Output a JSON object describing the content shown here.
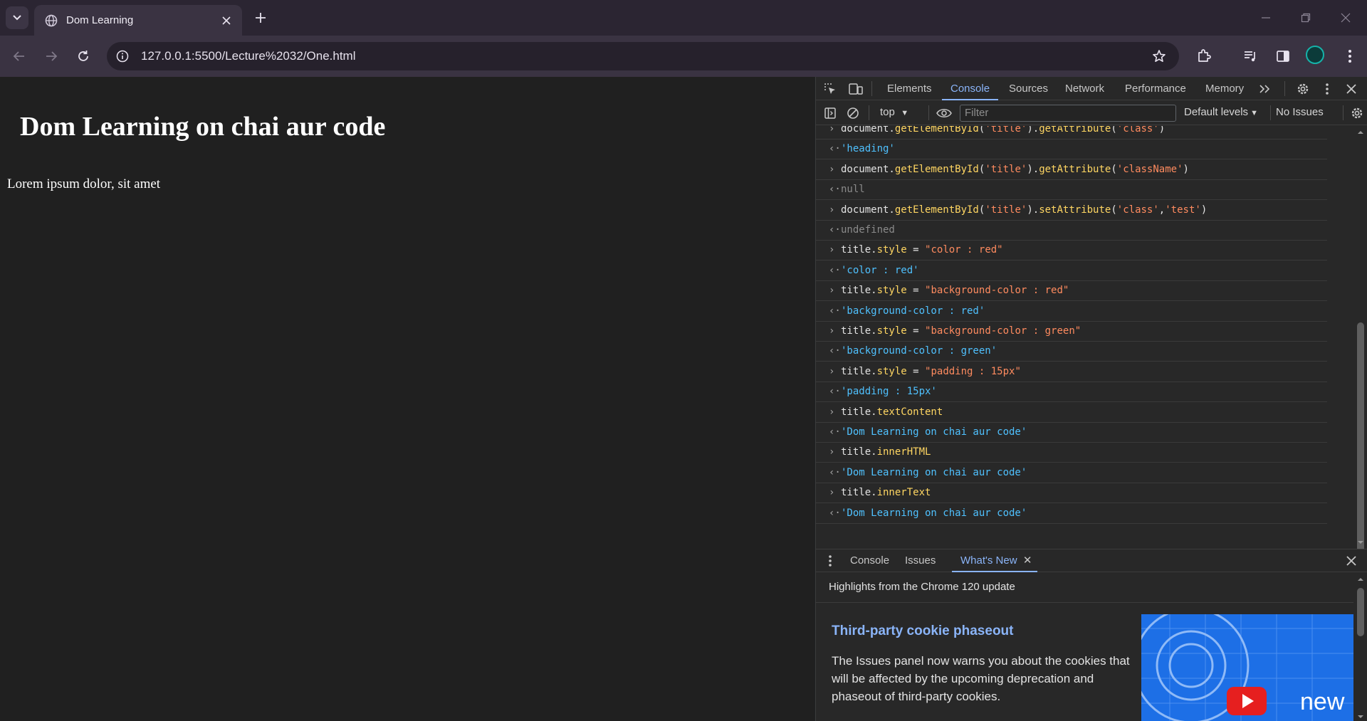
{
  "browser": {
    "tab_title": "Dom Learning",
    "url": "127.0.0.1:5500/Lecture%2032/One.html"
  },
  "page": {
    "heading": "Dom Learning on chai aur code",
    "paragraph": "Lorem ipsum dolor, sit amet"
  },
  "devtools": {
    "tabs": [
      "Elements",
      "Console",
      "Sources",
      "Network",
      "Performance",
      "Memory"
    ],
    "active_tab": "Console",
    "context": "top",
    "filter_placeholder": "Filter",
    "levels": "Default levels",
    "issues": "No Issues",
    "console_entries": [
      {
        "type": "input",
        "parts": [
          [
            "plain",
            "document."
          ],
          [
            "prop",
            "getElementById"
          ],
          [
            "plain",
            "("
          ],
          [
            "str",
            "'title'"
          ],
          [
            "plain",
            ")."
          ],
          [
            "prop",
            "getAttribute"
          ],
          [
            "plain",
            "("
          ],
          [
            "str",
            "'class'"
          ],
          [
            "plain",
            ")"
          ]
        ]
      },
      {
        "type": "output",
        "parts": [
          [
            "result",
            "'heading'"
          ]
        ]
      },
      {
        "type": "input",
        "parts": [
          [
            "plain",
            "document."
          ],
          [
            "prop",
            "getElementById"
          ],
          [
            "plain",
            "("
          ],
          [
            "str",
            "'title'"
          ],
          [
            "plain",
            ")."
          ],
          [
            "prop",
            "getAttribute"
          ],
          [
            "plain",
            "("
          ],
          [
            "str",
            "'className'"
          ],
          [
            "plain",
            ")"
          ]
        ]
      },
      {
        "type": "output",
        "parts": [
          [
            "null",
            "null"
          ]
        ]
      },
      {
        "type": "input",
        "parts": [
          [
            "plain",
            "document."
          ],
          [
            "prop",
            "getElementById"
          ],
          [
            "plain",
            "("
          ],
          [
            "str",
            "'title'"
          ],
          [
            "plain",
            ")."
          ],
          [
            "prop",
            "setAttribute"
          ],
          [
            "plain",
            "("
          ],
          [
            "str",
            "'class'"
          ],
          [
            "plain",
            ","
          ],
          [
            "str",
            "'test'"
          ],
          [
            "plain",
            ")"
          ]
        ]
      },
      {
        "type": "output",
        "parts": [
          [
            "null",
            "undefined"
          ]
        ]
      },
      {
        "type": "input",
        "parts": [
          [
            "plain",
            "title."
          ],
          [
            "prop",
            "style"
          ],
          [
            "plain",
            " = "
          ],
          [
            "str",
            "\"color : red\""
          ]
        ]
      },
      {
        "type": "output",
        "parts": [
          [
            "result",
            "'color : red'"
          ]
        ]
      },
      {
        "type": "input",
        "parts": [
          [
            "plain",
            "title."
          ],
          [
            "prop",
            "style"
          ],
          [
            "plain",
            " = "
          ],
          [
            "str",
            "\"background-color : red\""
          ]
        ]
      },
      {
        "type": "output",
        "parts": [
          [
            "result",
            "'background-color : red'"
          ]
        ]
      },
      {
        "type": "input",
        "parts": [
          [
            "plain",
            "title."
          ],
          [
            "prop",
            "style"
          ],
          [
            "plain",
            " = "
          ],
          [
            "str",
            "\"background-color : green\""
          ]
        ]
      },
      {
        "type": "output",
        "parts": [
          [
            "result",
            "'background-color : green'"
          ]
        ]
      },
      {
        "type": "input",
        "parts": [
          [
            "plain",
            "title."
          ],
          [
            "prop",
            "style"
          ],
          [
            "plain",
            " = "
          ],
          [
            "str",
            "\"padding : 15px\""
          ]
        ]
      },
      {
        "type": "output",
        "parts": [
          [
            "result",
            "'padding : 15px'"
          ]
        ]
      },
      {
        "type": "input",
        "parts": [
          [
            "plain",
            "title."
          ],
          [
            "prop",
            "textContent"
          ]
        ]
      },
      {
        "type": "output",
        "parts": [
          [
            "result",
            "'Dom Learning on chai aur code'"
          ]
        ]
      },
      {
        "type": "input",
        "parts": [
          [
            "plain",
            "title."
          ],
          [
            "prop",
            "innerHTML"
          ]
        ]
      },
      {
        "type": "output",
        "parts": [
          [
            "result",
            "'Dom Learning on chai aur code'"
          ]
        ]
      },
      {
        "type": "input",
        "parts": [
          [
            "plain",
            "title."
          ],
          [
            "prop",
            "innerText"
          ]
        ]
      },
      {
        "type": "output",
        "parts": [
          [
            "result",
            "'Dom Learning on chai aur code'"
          ]
        ]
      }
    ],
    "drawer": {
      "tabs": [
        "Console",
        "Issues",
        "What's New"
      ],
      "active_tab": "What's New",
      "highlight": "Highlights from the Chrome 120 update",
      "feature_title": "Third-party cookie phaseout",
      "feature_text": "The Issues panel now warns you about the cookies that will be affected by the upcoming deprecation and phaseout of third-party cookies.",
      "image_label": "new"
    }
  },
  "colors": {
    "accent": "#8ab4f8",
    "string": "#ff8b5f",
    "property": "#ffd662",
    "result": "#4fc1ff"
  }
}
